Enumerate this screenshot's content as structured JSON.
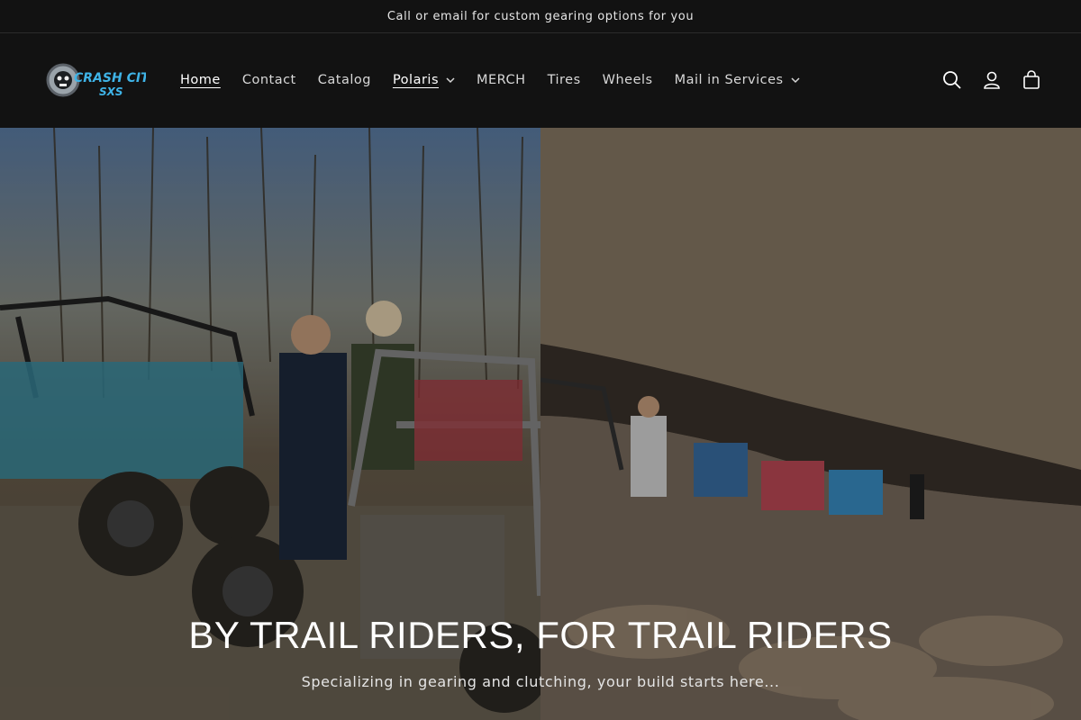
{
  "announcement": {
    "text": "Call or email for custom gearing options for you"
  },
  "logo": {
    "text_top": "CRASH CITY",
    "text_bottom": "SXS",
    "alt": "Crash City SXS"
  },
  "nav": {
    "items": [
      {
        "label": "Home",
        "dropdown": false
      },
      {
        "label": "Contact",
        "dropdown": false
      },
      {
        "label": "Catalog",
        "dropdown": false
      },
      {
        "label": "Polaris",
        "dropdown": true
      },
      {
        "label": "MERCH",
        "dropdown": false
      },
      {
        "label": "Tires",
        "dropdown": false
      },
      {
        "label": "Wheels",
        "dropdown": false
      },
      {
        "label": "Mail in Services",
        "dropdown": true
      }
    ]
  },
  "icons": {
    "search": "search-icon",
    "account": "account-icon",
    "cart": "cart-icon"
  },
  "hero": {
    "title": "BY TRAIL RIDERS, FOR TRAIL RIDERS",
    "subtitle": "Specializing in gearing and clutching, your build starts here..."
  },
  "colors": {
    "header_bg": "#121212",
    "logo_blue": "#3fb4e8"
  }
}
